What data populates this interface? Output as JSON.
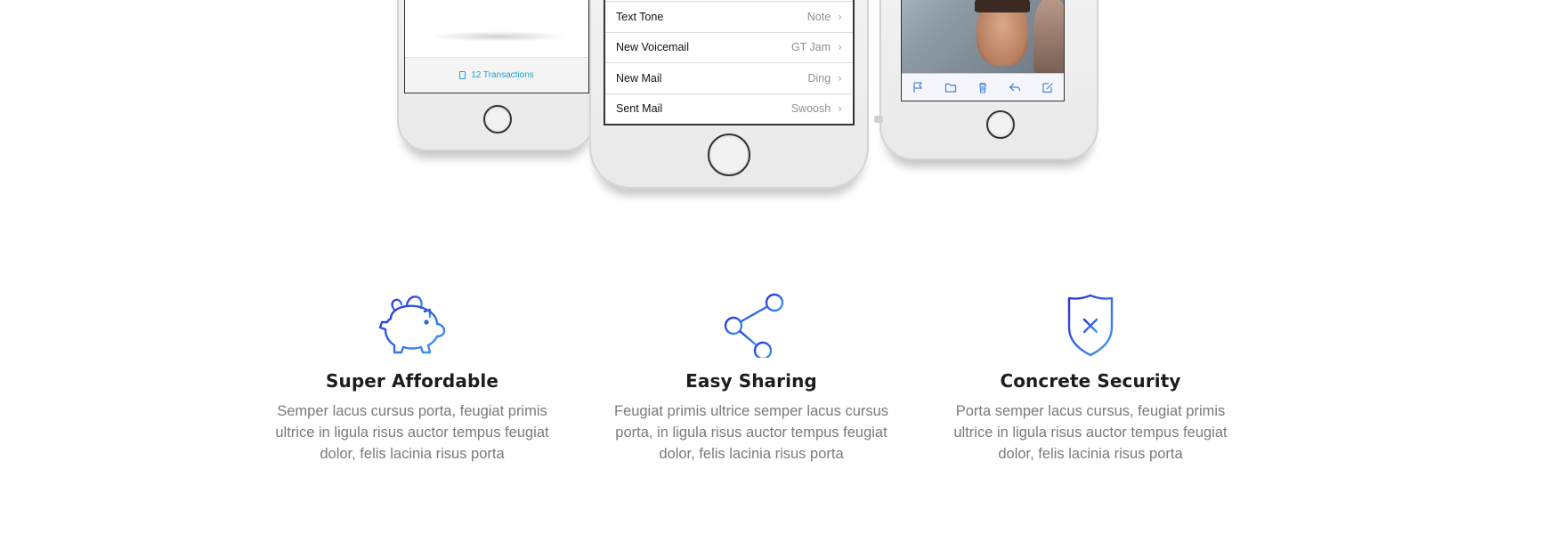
{
  "phone_left": {
    "transactions_label": "12 Transactions"
  },
  "phone_middle": {
    "rows": [
      {
        "label": "Text Tone",
        "value": "Note"
      },
      {
        "label": "New Voicemail",
        "value": "GT Jam"
      },
      {
        "label": "New Mail",
        "value": "Ding"
      },
      {
        "label": "Sent Mail",
        "value": "Swoosh"
      }
    ]
  },
  "phone_right": {
    "toolbar_icons": [
      "flag-icon",
      "folder-icon",
      "trash-icon",
      "reply-icon",
      "compose-icon"
    ]
  },
  "features": [
    {
      "icon": "piggy-bank-icon",
      "title": "Super Affordable",
      "description": "Semper lacus cursus porta, feugiat primis ultrice in ligula risus auctor tempus feugiat dolor, felis lacinia risus porta"
    },
    {
      "icon": "share-icon",
      "title": "Easy Sharing",
      "description": "Feugiat primis ultrice semper lacus cursus porta, in ligula risus auctor tempus feugiat dolor, felis lacinia risus porta"
    },
    {
      "icon": "shield-icon",
      "title": "Concrete Security",
      "description": "Porta semper lacus cursus, feugiat primis ultrice in ligula risus auctor tempus feugiat dolor, felis lacinia risus porta"
    }
  ],
  "colors": {
    "icon_gradient_start": "#2f2fd6",
    "icon_gradient_end": "#3fa0f0",
    "transactions_text": "#1aa3c9",
    "title_text": "#1c1c1c",
    "body_text": "#7a7a7a"
  }
}
